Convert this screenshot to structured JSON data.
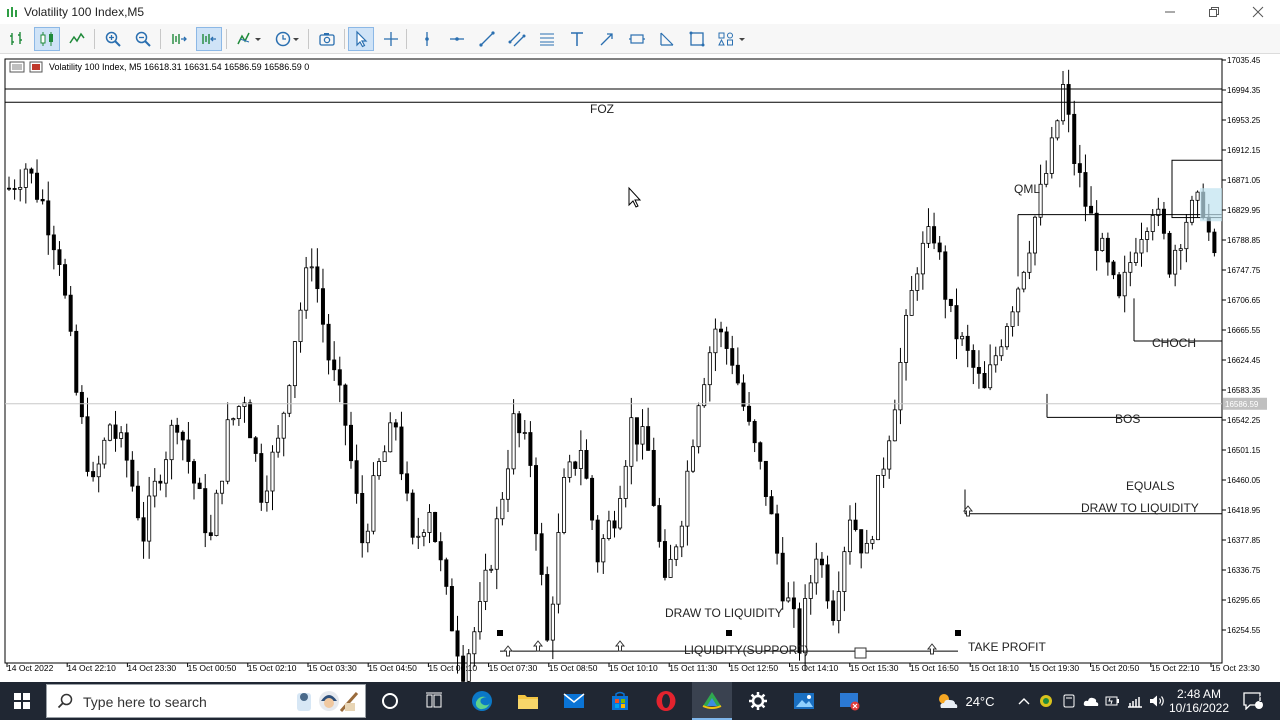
{
  "window": {
    "title": "Volatility 100 Index,M5"
  },
  "chart": {
    "header_info": "Volatility 100 Index, M5  16618.31 16631.54 16586.59 16586.59  0",
    "current_price_tag": "16586.59",
    "y_axis_labels": [
      "17035.45",
      "16994.35",
      "16953.25",
      "16912.15",
      "16871.05",
      "16829.95",
      "16788.85",
      "16747.75",
      "16706.65",
      "16665.55",
      "16624.45",
      "16583.35",
      "16542.25",
      "16501.15",
      "16460.05",
      "16418.95",
      "16377.85",
      "16336.75",
      "16295.65",
      "16254.55"
    ],
    "x_axis_labels": [
      "14 Oct 2022",
      "14 Oct 22:10",
      "14 Oct 23:30",
      "15 Oct 00:50",
      "15 Oct 02:10",
      "15 Oct 03:30",
      "15 Oct 04:50",
      "15 Oct 06:10",
      "15 Oct 07:30",
      "15 Oct 08:50",
      "15 Oct 10:10",
      "15 Oct 11:30",
      "15 Oct 12:50",
      "15 Oct 14:10",
      "15 Oct 15:30",
      "15 Oct 16:50",
      "15 Oct 18:10",
      "15 Oct 19:30",
      "15 Oct 20:50",
      "15 Oct 22:10",
      "15 Oct 23:30"
    ],
    "annotations": {
      "foz": "FOZ",
      "qml": "QML",
      "choch": "CHOCH",
      "bos": "BOS",
      "equals": "EQUALS",
      "draw_liquidity_right": "DRAW TO LIQUIDITY",
      "draw_liquidity_bottom": "DRAW TO LIQUIDITY",
      "liquidity_support": "LIQUIDITY(SUPPORT)",
      "take_profit": "TAKE PROFIT"
    },
    "chart_data": {
      "type": "candlestick",
      "symbol": "Volatility 100 Index",
      "timeframe": "M5",
      "ohlc": {
        "open": 16618.31,
        "high": 16631.54,
        "low": 16586.59,
        "close": 16586.59
      },
      "ylim": [
        16233.8,
        17055.8
      ],
      "price_path": [
        [
          0,
          16880
        ],
        [
          3,
          16910
        ],
        [
          6,
          16860
        ],
        [
          9,
          16790
        ],
        [
          12,
          16600
        ],
        [
          15,
          16470
        ],
        [
          18,
          16560
        ],
        [
          21,
          16510
        ],
        [
          24,
          16410
        ],
        [
          27,
          16500
        ],
        [
          30,
          16570
        ],
        [
          33,
          16480
        ],
        [
          36,
          16400
        ],
        [
          39,
          16550
        ],
        [
          42,
          16600
        ],
        [
          45,
          16470
        ],
        [
          48,
          16530
        ],
        [
          51,
          16680
        ],
        [
          54,
          16790
        ],
        [
          57,
          16650
        ],
        [
          60,
          16560
        ],
        [
          63,
          16400
        ],
        [
          66,
          16500
        ],
        [
          69,
          16560
        ],
        [
          72,
          16390
        ],
        [
          75,
          16450
        ],
        [
          78,
          16320
        ],
        [
          81,
          16230
        ],
        [
          84,
          16300
        ],
        [
          87,
          16420
        ],
        [
          90,
          16560
        ],
        [
          93,
          16510
        ],
        [
          96,
          16260
        ],
        [
          99,
          16470
        ],
        [
          102,
          16530
        ],
        [
          105,
          16380
        ],
        [
          108,
          16440
        ],
        [
          111,
          16560
        ],
        [
          114,
          16520
        ],
        [
          117,
          16330
        ],
        [
          120,
          16440
        ],
        [
          123,
          16600
        ],
        [
          126,
          16690
        ],
        [
          129,
          16650
        ],
        [
          132,
          16550
        ],
        [
          135,
          16470
        ],
        [
          138,
          16340
        ],
        [
          141,
          16260
        ],
        [
          144,
          16390
        ],
        [
          147,
          16310
        ],
        [
          150,
          16440
        ],
        [
          153,
          16380
        ],
        [
          156,
          16510
        ],
        [
          159,
          16640
        ],
        [
          162,
          16780
        ],
        [
          165,
          16820
        ],
        [
          168,
          16700
        ],
        [
          171,
          16650
        ],
        [
          174,
          16600
        ],
        [
          177,
          16680
        ],
        [
          180,
          16750
        ],
        [
          183,
          16840
        ],
        [
          186,
          16930
        ],
        [
          188,
          17015
        ],
        [
          190,
          16920
        ],
        [
          192,
          16860
        ],
        [
          195,
          16790
        ],
        [
          198,
          16720
        ],
        [
          201,
          16810
        ],
        [
          204,
          16860
        ],
        [
          207,
          16780
        ],
        [
          210,
          16840
        ],
        [
          213,
          16860
        ],
        [
          216,
          16730
        ]
      ],
      "levels": [
        {
          "name": "foz-upper",
          "price": 17015
        },
        {
          "name": "foz-lower",
          "price": 16997
        },
        {
          "name": "qml",
          "price": 16844
        },
        {
          "name": "choch",
          "price": 16672
        },
        {
          "name": "bos",
          "price": 16568
        },
        {
          "name": "equals",
          "price": 16437
        },
        {
          "name": "liquidity-support",
          "price": 16250
        }
      ]
    }
  },
  "taskbar": {
    "search_placeholder": "Type here to search",
    "weather": "24°C",
    "time": "2:48 AM",
    "date": "10/16/2022",
    "notifications": "1"
  }
}
